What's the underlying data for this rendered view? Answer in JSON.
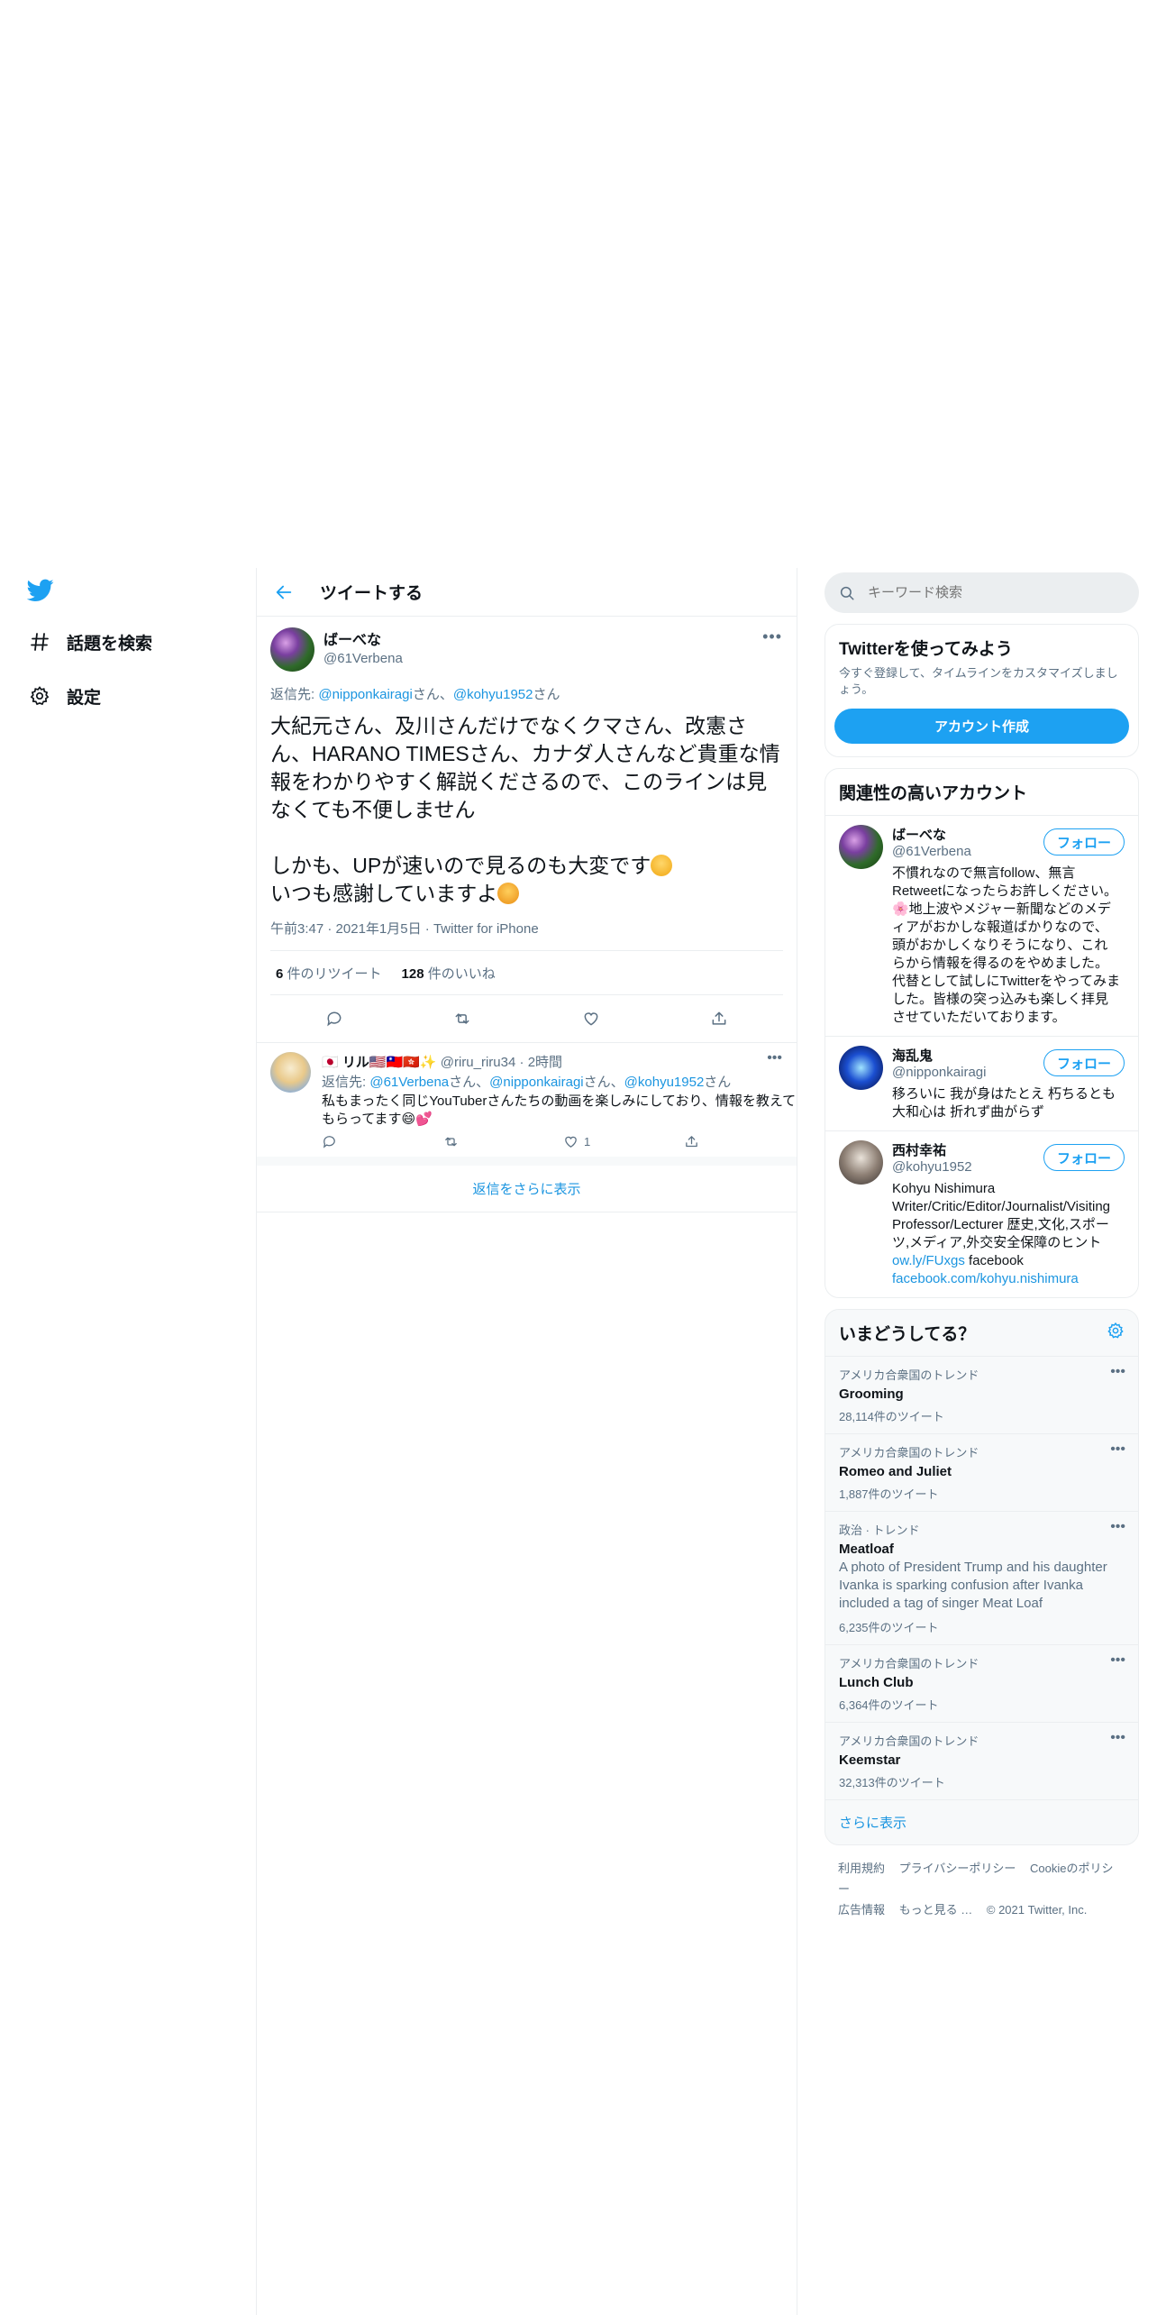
{
  "nav": {
    "items": [
      {
        "label": "話題を検索",
        "icon": "hashtag-icon"
      },
      {
        "label": "設定",
        "icon": "gear-icon"
      }
    ]
  },
  "header": {
    "title": "ツイートする"
  },
  "tweet": {
    "name": "ばーべな",
    "handle": "@61Verbena",
    "reply_prefix": "返信先: ",
    "reply_mentions": [
      "@nipponkairagi",
      "@kohyu1952"
    ],
    "reply_san": "さん",
    "reply_sep": "、",
    "body_1": "大紀元さん、及川さんだけでなくクマさん、改憲さん、HARANO TIMESさん、カナダ人さんなど貴重な情報をわかりやすく解説くださるので、このラインは見なくても不便しません\n\nしかも、UPが速いので見るのも大変です",
    "body_2": "いつも感謝していますよ",
    "time": "午前3:47",
    "date": "2021年1月5日",
    "source": "Twitter for iPhone",
    "retweets_count": "6",
    "retweets_label": "件のリツイート",
    "likes_count": "128",
    "likes_label": "件のいいね"
  },
  "reply": {
    "name": "リル",
    "handle": "@riru_riru34",
    "time": "2時間",
    "reply_prefix": "返信先: ",
    "mentions": [
      "@61Verbena",
      "@nipponkairagi",
      "@kohyu1952"
    ],
    "san": "さん",
    "sep": "、",
    "text": "私もまったく同じYouTuberさんたちの動画を楽しみにしており、情報を教えてもらってます",
    "like_count": "1"
  },
  "show_more_replies": "返信をさらに表示",
  "search": {
    "placeholder": "キーワード検索"
  },
  "signup": {
    "title": "Twitterを使ってみよう",
    "desc": "今すぐ登録して、タイムラインをカスタマイズしましょう。",
    "button": "アカウント作成"
  },
  "related": {
    "title": "関連性の高いアカウント",
    "follow_label": "フォロー",
    "accounts": [
      {
        "name": "ばーべな",
        "handle": "@61Verbena",
        "bio": "不慣れなので無言follow、無言Retweetになったらお許しください。🌸地上波やメジャー新聞などのメディアがおかしな報道ばかりなので、頭がおかしくなりそうになり、これらから情報を得るのをやめました。 代替として試しにTwitterをやってみました。皆様の突っ込みも楽しく拝見させていただいております。"
      },
      {
        "name": "海乱鬼",
        "handle": "@nipponkairagi",
        "bio": "移ろいに 我が身はたとえ 朽ちるとも 大和心は 折れず曲がらず"
      },
      {
        "name": "西村幸祐",
        "handle": "@kohyu1952",
        "bio": "Kohyu Nishimura Writer/Critic/Editor/Journalist/Visiting Professor/Lecturer 歴史,文化,スポーツ,メディア,外交安全保障のヒント",
        "link1": "ow.ly/FUxgs",
        "mid": " facebook ",
        "link2": "facebook.com/kohyu.nishimura"
      }
    ]
  },
  "trends": {
    "title": "いまどうしてる？",
    "items": [
      {
        "category": "アメリカ合衆国のトレンド",
        "name": "Grooming",
        "desc": "",
        "count": "28,114件のツイート"
      },
      {
        "category": "アメリカ合衆国のトレンド",
        "name": "Romeo and Juliet",
        "desc": "",
        "count": "1,887件のツイート"
      },
      {
        "category": "政治 · トレンド",
        "name": "Meatloaf",
        "desc": "A photo of President Trump and his daughter Ivanka is sparking confusion after Ivanka included a tag of singer Meat Loaf",
        "count": "6,235件のツイート"
      },
      {
        "category": "アメリカ合衆国のトレンド",
        "name": "Lunch Club",
        "desc": "",
        "count": "6,364件のツイート"
      },
      {
        "category": "アメリカ合衆国のトレンド",
        "name": "Keemstar",
        "desc": "",
        "count": "32,313件のツイート"
      }
    ],
    "show_more": "さらに表示"
  },
  "footer": {
    "links": [
      "利用規約",
      "プライバシーポリシー",
      "Cookieのポリシー",
      "広告情報",
      "もっと見る …"
    ],
    "copyright": "© 2021 Twitter, Inc."
  },
  "colors": {
    "accent": "#1da1f2",
    "link": "#1b95e0",
    "muted": "#5b7083",
    "border": "#ebeef0"
  }
}
